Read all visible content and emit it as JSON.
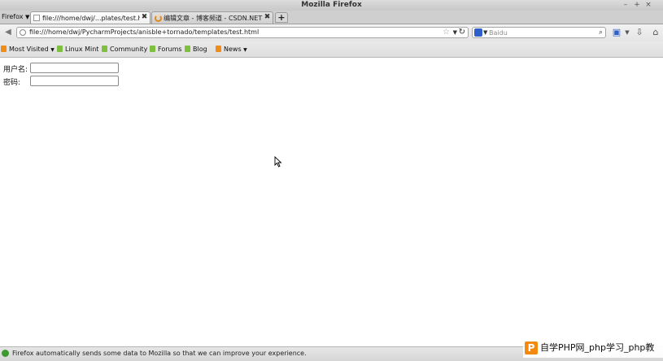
{
  "window": {
    "title": "Mozilla Firefox"
  },
  "app_menu": {
    "label": "Firefox"
  },
  "tabs": [
    {
      "label": "file:///home/dwj/...plates/test.html",
      "active": true
    },
    {
      "label": "编辑文章 - 博客频道 - CSDN.NET",
      "active": false,
      "loading": true
    }
  ],
  "navbar": {
    "url": "file:///home/dwj/PycharmProjects/anisble+tornado/templates/test.html",
    "search_placeholder": "Baidu"
  },
  "bookmarks": [
    {
      "label": "Most Visited",
      "icon": "rss-icon",
      "dropdown": true
    },
    {
      "label": "Linux Mint",
      "icon": "bookmark-icon"
    },
    {
      "label": "Community",
      "icon": "bookmark-icon"
    },
    {
      "label": "Forums",
      "icon": "bookmark-icon"
    },
    {
      "label": "Blog",
      "icon": "bookmark-icon"
    },
    {
      "label": "News",
      "icon": "rss-icon",
      "dropdown": true
    }
  ],
  "form": {
    "username_label": "用户名:",
    "username_value": "",
    "password_label": "密码:",
    "password_value": ""
  },
  "statusbar": {
    "message": "Firefox automatically sends some data to Mozilla so that we can improve your experience."
  },
  "watermark": {
    "logo": "P",
    "text": "自学PHP网_php学习_php教"
  },
  "colors": {
    "accent": "#f28a10",
    "status_icon": "#3c9a2f",
    "search_engine": "#2f5fc8"
  }
}
